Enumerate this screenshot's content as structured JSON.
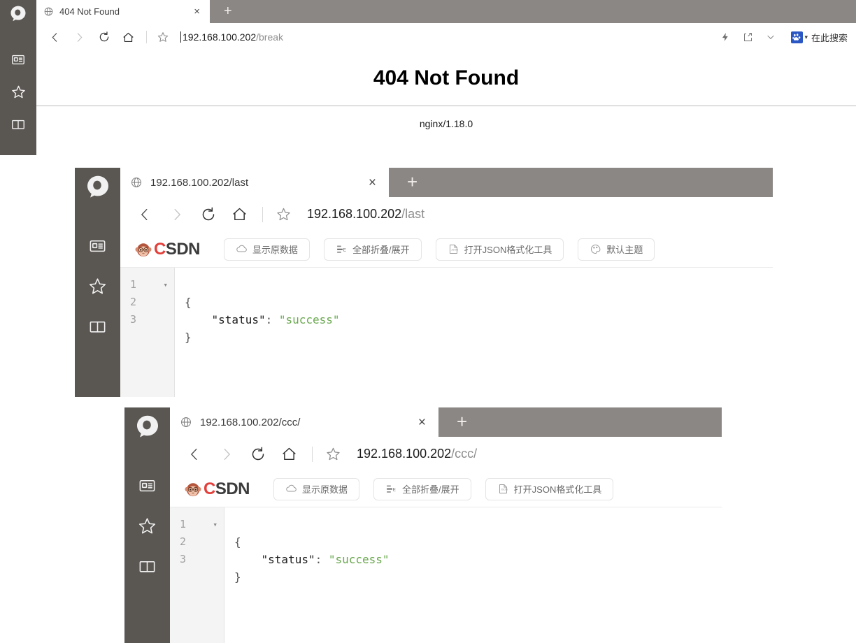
{
  "windows": [
    {
      "id": "window-404",
      "tab": {
        "title": "404 Not Found",
        "favicon": "globe-icon",
        "close": "×",
        "new_tab": "+"
      },
      "nav": {
        "back": "‹",
        "forward": "›",
        "reload": "reload-icon",
        "home": "home-icon",
        "bookmark": "star-icon",
        "url_host": "192.168.100.202",
        "url_path": "/break"
      },
      "toolbar_right": {
        "lightning": "lightning-icon",
        "share": "share-icon",
        "chevron": "chevron-down-icon",
        "baidu": "baidu-icon",
        "baidu_caret": "▾",
        "search_label": "在此搜索"
      },
      "page": {
        "heading": "404 Not Found",
        "server": "nginx/1.18.0"
      },
      "sidebar": [
        {
          "name": "qq-browser-logo",
          "icon": "qq-logo-icon"
        },
        {
          "name": "sidebar-item-news",
          "icon": "card-icon"
        },
        {
          "name": "sidebar-item-favorites",
          "icon": "star-icon"
        },
        {
          "name": "sidebar-item-reading",
          "icon": "book-icon"
        }
      ]
    },
    {
      "id": "window-last",
      "tab": {
        "title": "192.168.100.202/last",
        "favicon": "globe-icon",
        "close": "×",
        "new_tab": "+"
      },
      "nav": {
        "back": "‹",
        "forward": "›",
        "reload": "reload-icon",
        "home": "home-icon",
        "bookmark": "star-icon",
        "url_host": "192.168.100.202",
        "url_path": "/last"
      },
      "csdn": {
        "brand_c": "C",
        "brand_rest": "SDN",
        "buttons": [
          {
            "name": "show-raw-data-button",
            "icon": "cloud-icon",
            "label": "显示原数据"
          },
          {
            "name": "collapse-expand-all-button",
            "icon": "collapse-icon",
            "label": "全部折叠/展开"
          },
          {
            "name": "open-json-tool-button",
            "icon": "json-file-icon",
            "label": "打开JSON格式化工具"
          },
          {
            "name": "theme-button",
            "icon": "palette-icon",
            "label": "默认主题"
          }
        ]
      },
      "code": {
        "lines": [
          "1",
          "2",
          "3"
        ],
        "fold_marker": "▾",
        "l1": "{",
        "l2_key": "\"status\"",
        "l2_colon": ": ",
        "l2_value": "\"success\"",
        "l3": "}"
      },
      "sidebar": [
        {
          "name": "qq-browser-logo",
          "icon": "qq-logo-icon"
        },
        {
          "name": "sidebar-item-news",
          "icon": "card-icon"
        },
        {
          "name": "sidebar-item-favorites",
          "icon": "star-icon"
        },
        {
          "name": "sidebar-item-reading",
          "icon": "book-icon"
        }
      ]
    },
    {
      "id": "window-ccc",
      "tab": {
        "title": "192.168.100.202/ccc/",
        "favicon": "globe-icon",
        "close": "×",
        "new_tab": "+"
      },
      "nav": {
        "back": "‹",
        "forward": "›",
        "reload": "reload-icon",
        "home": "home-icon",
        "bookmark": "star-icon",
        "url_host": "192.168.100.202",
        "url_path": "/ccc/"
      },
      "csdn": {
        "brand_c": "C",
        "brand_rest": "SDN",
        "buttons": [
          {
            "name": "show-raw-data-button",
            "icon": "cloud-icon",
            "label": "显示原数据"
          },
          {
            "name": "collapse-expand-all-button",
            "icon": "collapse-icon",
            "label": "全部折叠/展开"
          },
          {
            "name": "open-json-tool-button",
            "icon": "json-file-icon",
            "label": "打开JSON格式化工具"
          }
        ]
      },
      "code": {
        "lines": [
          "1",
          "2",
          "3"
        ],
        "fold_marker": "▾",
        "l1": "{",
        "l2_key": "\"status\"",
        "l2_colon": ": ",
        "l2_value": "\"success\"",
        "l3": "}"
      },
      "sidebar": [
        {
          "name": "qq-browser-logo",
          "icon": "qq-logo-icon"
        },
        {
          "name": "sidebar-item-news",
          "icon": "card-icon"
        },
        {
          "name": "sidebar-item-favorites",
          "icon": "star-icon"
        },
        {
          "name": "sidebar-item-reading",
          "icon": "book-icon"
        }
      ]
    }
  ],
  "colors": {
    "sidebar_bg": "#5a5753",
    "tabstrip_bg": "#8a8784",
    "json_value_green": "#6aa84f",
    "csdn_red": "#e3403b",
    "baidu_blue": "#2b57c4"
  }
}
